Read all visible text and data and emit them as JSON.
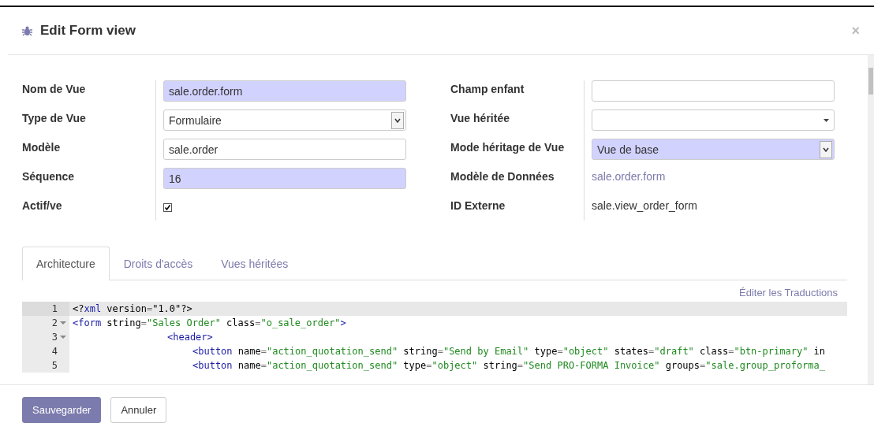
{
  "dialog": {
    "title": "Edit Form view",
    "close": "×"
  },
  "form": {
    "left": [
      {
        "label": "Nom de Vue",
        "kind": "input",
        "value": "sale.order.form",
        "required": true
      },
      {
        "label": "Type de Vue",
        "kind": "select",
        "value": "Formulaire",
        "required": false
      },
      {
        "label": "Modèle",
        "kind": "input",
        "value": "sale.order",
        "required": false
      },
      {
        "label": "Séquence",
        "kind": "input",
        "value": "16",
        "required": true
      },
      {
        "label": "Actif/ve",
        "kind": "checkbox",
        "checked": true
      }
    ],
    "right": [
      {
        "label": "Champ enfant",
        "kind": "input",
        "required": false
      },
      {
        "label": "Vue héritée",
        "kind": "dropdown",
        "required": false
      },
      {
        "label": "Mode héritage de Vue",
        "kind": "select",
        "value": "Vue de base",
        "required": true
      },
      {
        "label": "Modèle de Données",
        "kind": "link",
        "value": "sale.order.form"
      },
      {
        "label": "ID Externe",
        "kind": "text",
        "value": "sale.view_order_form"
      }
    ]
  },
  "tabs": [
    {
      "label": "Architecture",
      "selected": true
    },
    {
      "label": "Droits d'accès",
      "selected": false
    },
    {
      "label": "Vues héritées",
      "selected": false
    }
  ],
  "translate_link": "Éditer les Traductions",
  "editor": {
    "lines": [
      {
        "number": "1",
        "active": true,
        "tokens": [
          {
            "kind": "punct",
            "text": "<?"
          },
          {
            "kind": "tag",
            "text": "xml"
          },
          {
            "kind": "attr",
            "text": " version"
          },
          {
            "kind": "eq",
            "text": "="
          },
          {
            "kind": "plain",
            "text": "\"1.0\"?>"
          }
        ]
      },
      {
        "number": "2",
        "active": false,
        "expanded": true,
        "tokens": [
          {
            "kind": "tag",
            "text": "<form"
          },
          {
            "kind": "attr",
            "text": " string"
          },
          {
            "kind": "eq",
            "text": "="
          },
          {
            "kind": "string",
            "text": "\"Sales Order\""
          },
          {
            "kind": "attr",
            "text": " class"
          },
          {
            "kind": "eq",
            "text": "="
          },
          {
            "kind": "string",
            "text": "\"o_sale_order\""
          },
          {
            "kind": "tag",
            "text": ">"
          }
        ],
        "children": [
          {
            "number": "3",
            "active": false,
            "expanded": true,
            "tokens": [
              {
                "kind": "tag",
                "text": "<header>"
              }
            ],
            "children": [
              {
                "number": "4",
                "active": false,
                "tokens": [
                  {
                    "kind": "tag",
                    "text": "<button"
                  },
                  {
                    "kind": "attr",
                    "text": " name"
                  },
                  {
                    "kind": "eq",
                    "text": "="
                  },
                  {
                    "kind": "string",
                    "text": "\"action_quotation_send\""
                  },
                  {
                    "kind": "attr",
                    "text": " string"
                  },
                  {
                    "kind": "eq",
                    "text": "="
                  },
                  {
                    "kind": "string",
                    "text": "\"Send by Email\""
                  },
                  {
                    "kind": "attr",
                    "text": " type"
                  },
                  {
                    "kind": "eq",
                    "text": "="
                  },
                  {
                    "kind": "string",
                    "text": "\"object\""
                  },
                  {
                    "kind": "attr",
                    "text": " states"
                  },
                  {
                    "kind": "eq",
                    "text": "="
                  },
                  {
                    "kind": "string",
                    "text": "\"draft\""
                  },
                  {
                    "kind": "attr",
                    "text": " class"
                  },
                  {
                    "kind": "eq",
                    "text": "="
                  },
                  {
                    "kind": "string",
                    "text": "\"btn-primary\""
                  },
                  {
                    "kind": "attr",
                    "text": " in"
                  }
                ]
              },
              {
                "number": "5",
                "active": false,
                "tokens": [
                  {
                    "kind": "tag",
                    "text": "<button"
                  },
                  {
                    "kind": "attr",
                    "text": " name"
                  },
                  {
                    "kind": "eq",
                    "text": "="
                  },
                  {
                    "kind": "string",
                    "text": "\"action_quotation_send\""
                  },
                  {
                    "kind": "attr",
                    "text": " type"
                  },
                  {
                    "kind": "eq",
                    "text": "="
                  },
                  {
                    "kind": "string",
                    "text": "\"object\""
                  },
                  {
                    "kind": "attr",
                    "text": " string"
                  },
                  {
                    "kind": "eq",
                    "text": "="
                  },
                  {
                    "kind": "string",
                    "text": "\"Send PRO-FORMA Invoice\""
                  },
                  {
                    "kind": "attr",
                    "text": " groups"
                  },
                  {
                    "kind": "eq",
                    "text": "="
                  },
                  {
                    "kind": "string",
                    "text": "\"sale.group_proforma_"
                  }
                ]
              }
            ]
          }
        ]
      }
    ]
  },
  "buttons": [
    {
      "label": "Sauvegarder",
      "kind": "primary"
    },
    {
      "label": "Annuler",
      "kind": "secondary"
    }
  ]
}
